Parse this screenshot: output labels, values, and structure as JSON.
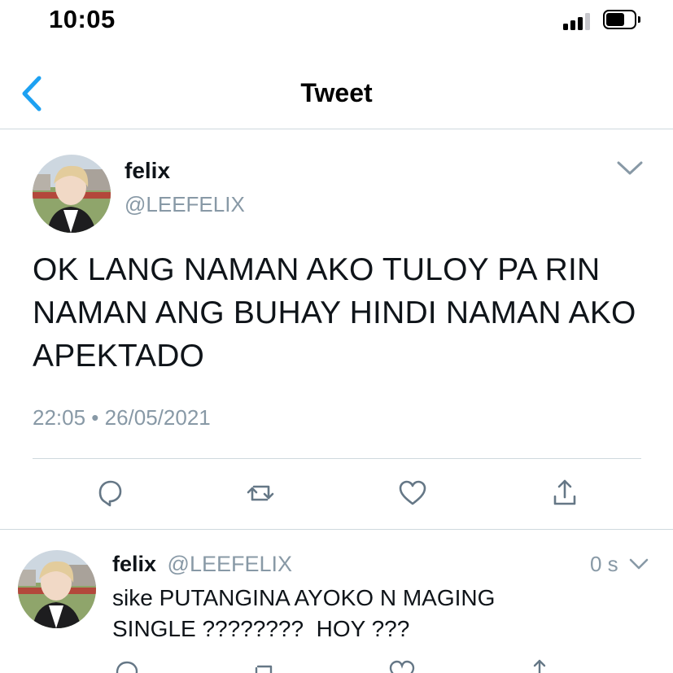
{
  "status_bar": {
    "time": "10:05"
  },
  "nav": {
    "title": "Tweet",
    "back_icon": "chevron-left-icon"
  },
  "main_tweet": {
    "name": "felix",
    "handle": "@LEEFELIX",
    "text": "OK LANG NAMAN AKO TULOY PA RIN NAMAN ANG BUHAY HINDI NAMAN AKO APEKTADO",
    "timestamp": "22:05 • 26/05/2021",
    "actions": [
      "reply-icon",
      "retweet-icon",
      "like-icon",
      "share-icon"
    ]
  },
  "reply_tweet": {
    "name": "felix",
    "handle": "@LEEFELIX",
    "time": "0 s",
    "text_line1": "sike PUTANGINA AYOKO N MAGING",
    "text_line2": "SINGLE ????????  HOY ???"
  },
  "colors": {
    "accent": "#1da1f2",
    "text": "#0f1419",
    "muted": "#8899a6",
    "icon": "#657786",
    "divider": "#cfd9de"
  }
}
